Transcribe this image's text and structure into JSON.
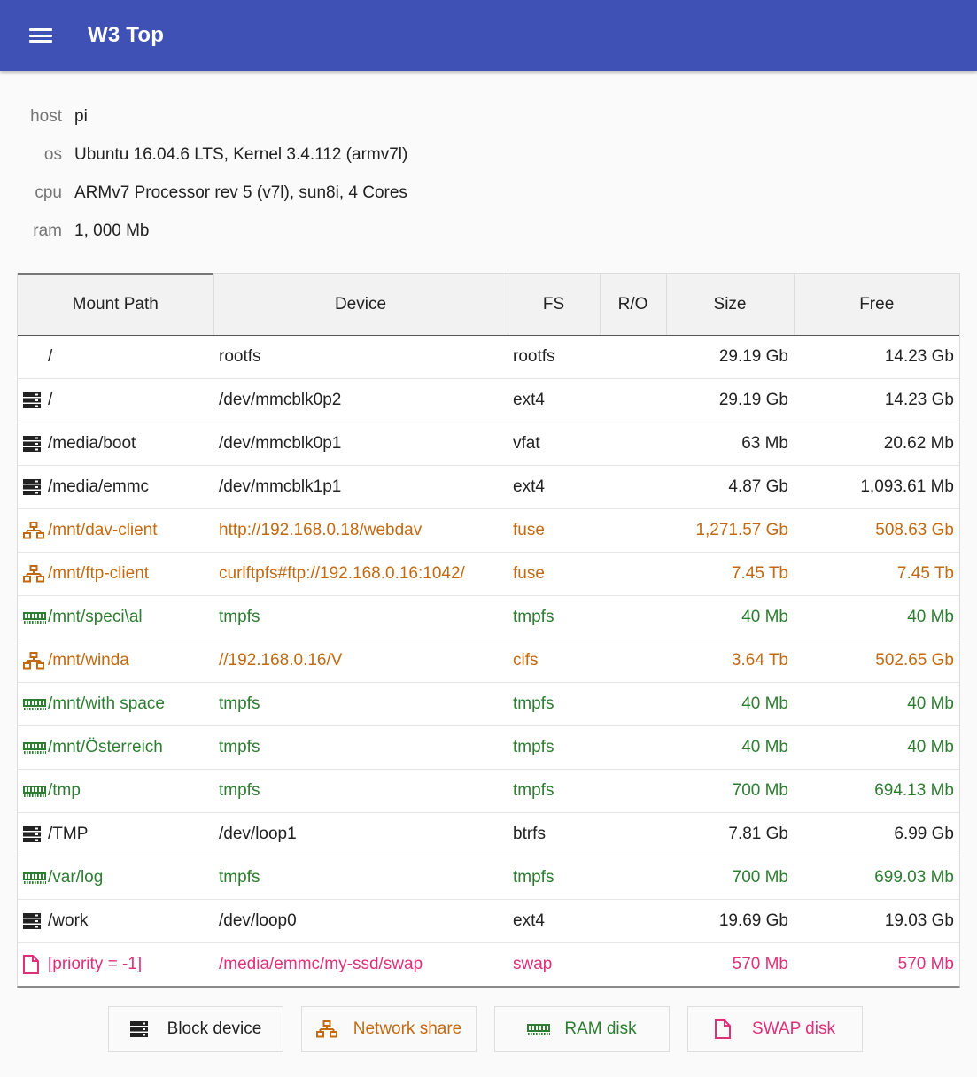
{
  "app": {
    "title": "W3 Top"
  },
  "system": {
    "host_label": "host",
    "host_value": "pi",
    "os_label": "os",
    "os_value": "Ubuntu 16.04.6 LTS, Kernel 3.4.112 (armv7l)",
    "cpu_label": "cpu",
    "cpu_value": "ARMv7 Processor rev 5 (v7l), sun8i, 4 Cores",
    "ram_label": "ram",
    "ram_value": "1, 000 Mb"
  },
  "table": {
    "headers": {
      "mount": "Mount Path",
      "device": "Device",
      "fs": "FS",
      "ro": "R/O",
      "size": "Size",
      "free": "Free"
    },
    "rows": [
      {
        "kind": "none",
        "icon": "",
        "mount": "/",
        "device": "rootfs",
        "fs": "rootfs",
        "ro": "",
        "size": "29.19 Gb",
        "free": "14.23 Gb"
      },
      {
        "kind": "block",
        "icon": "block-device-icon",
        "mount": "/",
        "device": "/dev/mmcblk0p2",
        "fs": "ext4",
        "ro": "",
        "size": "29.19 Gb",
        "free": "14.23 Gb"
      },
      {
        "kind": "block",
        "icon": "block-device-icon",
        "mount": "/media/boot",
        "device": "/dev/mmcblk0p1",
        "fs": "vfat",
        "ro": "",
        "size": "63 Mb",
        "free": "20.62 Mb"
      },
      {
        "kind": "block",
        "icon": "block-device-icon",
        "mount": "/media/emmc",
        "device": "/dev/mmcblk1p1",
        "fs": "ext4",
        "ro": "",
        "size": "4.87 Gb",
        "free": "1,093.61 Mb"
      },
      {
        "kind": "net",
        "icon": "network-share-icon",
        "mount": "/mnt/dav-client",
        "device": "http://192.168.0.18/webdav",
        "fs": "fuse",
        "ro": "",
        "size": "1,271.57 Gb",
        "free": "508.63 Gb"
      },
      {
        "kind": "net",
        "icon": "network-share-icon",
        "mount": "/mnt/ftp-client",
        "device": "curlftpfs#ftp://192.168.0.16:1042/",
        "fs": "fuse",
        "ro": "",
        "size": "7.45 Tb",
        "free": "7.45 Tb"
      },
      {
        "kind": "ram",
        "icon": "ram-disk-icon",
        "mount": "/mnt/speci\\al",
        "device": "tmpfs",
        "fs": "tmpfs",
        "ro": "",
        "size": "40 Mb",
        "free": "40 Mb"
      },
      {
        "kind": "net",
        "icon": "network-share-icon",
        "mount": "/mnt/winda",
        "device": "//192.168.0.16/V",
        "fs": "cifs",
        "ro": "",
        "size": "3.64 Tb",
        "free": "502.65 Gb"
      },
      {
        "kind": "ram",
        "icon": "ram-disk-icon",
        "mount": "/mnt/with space",
        "device": "tmpfs",
        "fs": "tmpfs",
        "ro": "",
        "size": "40 Mb",
        "free": "40 Mb"
      },
      {
        "kind": "ram",
        "icon": "ram-disk-icon",
        "mount": "/mnt/Österreich",
        "device": "tmpfs",
        "fs": "tmpfs",
        "ro": "",
        "size": "40 Mb",
        "free": "40 Mb"
      },
      {
        "kind": "ram",
        "icon": "ram-disk-icon",
        "mount": "/tmp",
        "device": "tmpfs",
        "fs": "tmpfs",
        "ro": "",
        "size": "700 Mb",
        "free": "694.13 Mb"
      },
      {
        "kind": "block",
        "icon": "block-device-icon",
        "mount": "/TMP",
        "device": "/dev/loop1",
        "fs": "btrfs",
        "ro": "",
        "size": "7.81 Gb",
        "free": "6.99 Gb"
      },
      {
        "kind": "ram",
        "icon": "ram-disk-icon",
        "mount": "/var/log",
        "device": "tmpfs",
        "fs": "tmpfs",
        "ro": "",
        "size": "700 Mb",
        "free": "699.03 Mb"
      },
      {
        "kind": "block",
        "icon": "block-device-icon",
        "mount": "/work",
        "device": "/dev/loop0",
        "fs": "ext4",
        "ro": "",
        "size": "19.69 Gb",
        "free": "19.03 Gb"
      },
      {
        "kind": "swap",
        "icon": "swap-disk-icon",
        "mount": "[priority = -1]",
        "device": "/media/emmc/my-ssd/swap",
        "fs": "swap",
        "ro": "",
        "size": "570 Mb",
        "free": "570 Mb"
      }
    ]
  },
  "legend": {
    "block": "Block device",
    "net": "Network share",
    "ram": "RAM disk",
    "swap": "SWAP disk"
  },
  "colors": {
    "appbar": "#3f51b5",
    "block": "#222222",
    "net": "#c26a12",
    "ram": "#2e7d32",
    "swap": "#e0307a"
  }
}
